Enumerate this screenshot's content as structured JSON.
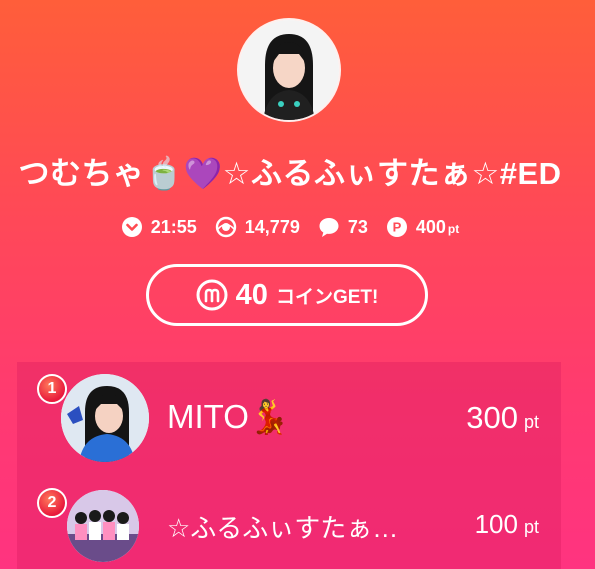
{
  "broadcaster": {
    "title": "つむちゃ🍵💜☆ふるふぃすたぁ☆#ED",
    "avatar_icon": "user-avatar"
  },
  "stats": {
    "duration": "21:55",
    "viewers": "14,779",
    "comments": "73",
    "points": "400",
    "points_unit": "pt"
  },
  "coin_button": {
    "amount": "40",
    "label": "コインGET!"
  },
  "ranking": [
    {
      "rank": "1",
      "name": "MITO💃",
      "points": "300",
      "unit": "pt"
    },
    {
      "rank": "2",
      "name": "☆ふるふぃすたぁ…",
      "points": "100",
      "unit": "pt"
    }
  ],
  "colors": {
    "gradient_top": "#ff5e3a",
    "gradient_bottom": "#ff3380",
    "badge": "#e8193c"
  }
}
